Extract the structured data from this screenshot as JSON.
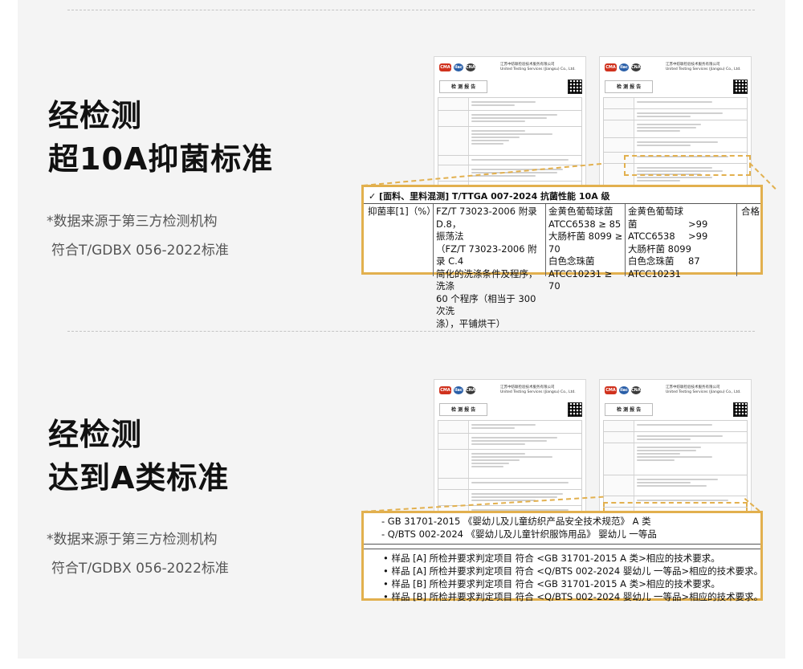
{
  "sections": [
    {
      "headline_line1": "经检测",
      "headline_line2": "超10A抑菌标准",
      "note_line1": "*数据来源于第三方检测机构",
      "note_line2": "符合T/GDBX 056-2022标准"
    },
    {
      "headline_line1": "经检测",
      "headline_line2": "达到A类标准",
      "note_line1": "*数据来源于第三方检测机构",
      "note_line2": "符合T/GDBX 056-2022标准"
    }
  ],
  "doc_thumb": {
    "org_cn": "江苏中纺联检验技术服务有限公司",
    "org_en": "United Testing Services (Jiangsu) Co., Ltd.",
    "report_title": "检 测 报 告",
    "logo_a": "CMA",
    "logo_b": "ilac",
    "logo_c": "CNAS"
  },
  "callout1": {
    "header": "✓  [面料、里料混测]   T/TTGA 007-2024  抗菌性能   10A 级",
    "item_label": "抑菌率[1]（%）",
    "method": [
      "FZ/T 73023-2006  附录 D.8，",
      "振荡法",
      "（FZ/T 73023-2006  附录 C.4",
      "简化的洗涤条件及程序，洗涤",
      "60 个程序（相当于 300 次洗",
      "涤），平铺烘干）"
    ],
    "requirement": [
      "金黄色葡萄球菌",
      "ATCC6538 ≥ 85",
      "大肠杆菌 8099 ≥ 70",
      "白色念珠菌",
      "ATCC10231 ≥ 70"
    ],
    "results_left": [
      "金黄色葡萄球菌",
      "ATCC6538",
      "大肠杆菌 8099",
      "白色念珠菌",
      "ATCC10231"
    ],
    "results_right": [
      "",
      ">99",
      ">99",
      "",
      "87"
    ],
    "verdict": "合格"
  },
  "callout2": {
    "standards": [
      "- GB 31701-2015 《婴幼儿及儿童纺织产品安全技术规范》 A 类",
      "- Q/BTS 002-2024 《婴幼儿及儿童针织服饰用品》 婴幼儿 一等品"
    ],
    "conclusions": [
      "• 样品 [A] 所检并要求判定项目  符合  <GB 31701-2015 A 类>相应的技术要求。",
      "• 样品 [A] 所检并要求判定项目  符合  <Q/BTS 002-2024  婴幼儿 一等品>相应的技术要求。",
      "• 样品 [B] 所检并要求判定项目  符合  <GB 31701-2015 A 类>相应的技术要求。",
      "• 样品 [B] 所检并要求判定项目  符合  <Q/BTS 002-2024  婴幼儿 一等品>相应的技术要求。"
    ]
  },
  "colors": {
    "accent": "#e2b04e",
    "background": "#f4f4f4",
    "headline": "#111111",
    "note": "#555555"
  }
}
